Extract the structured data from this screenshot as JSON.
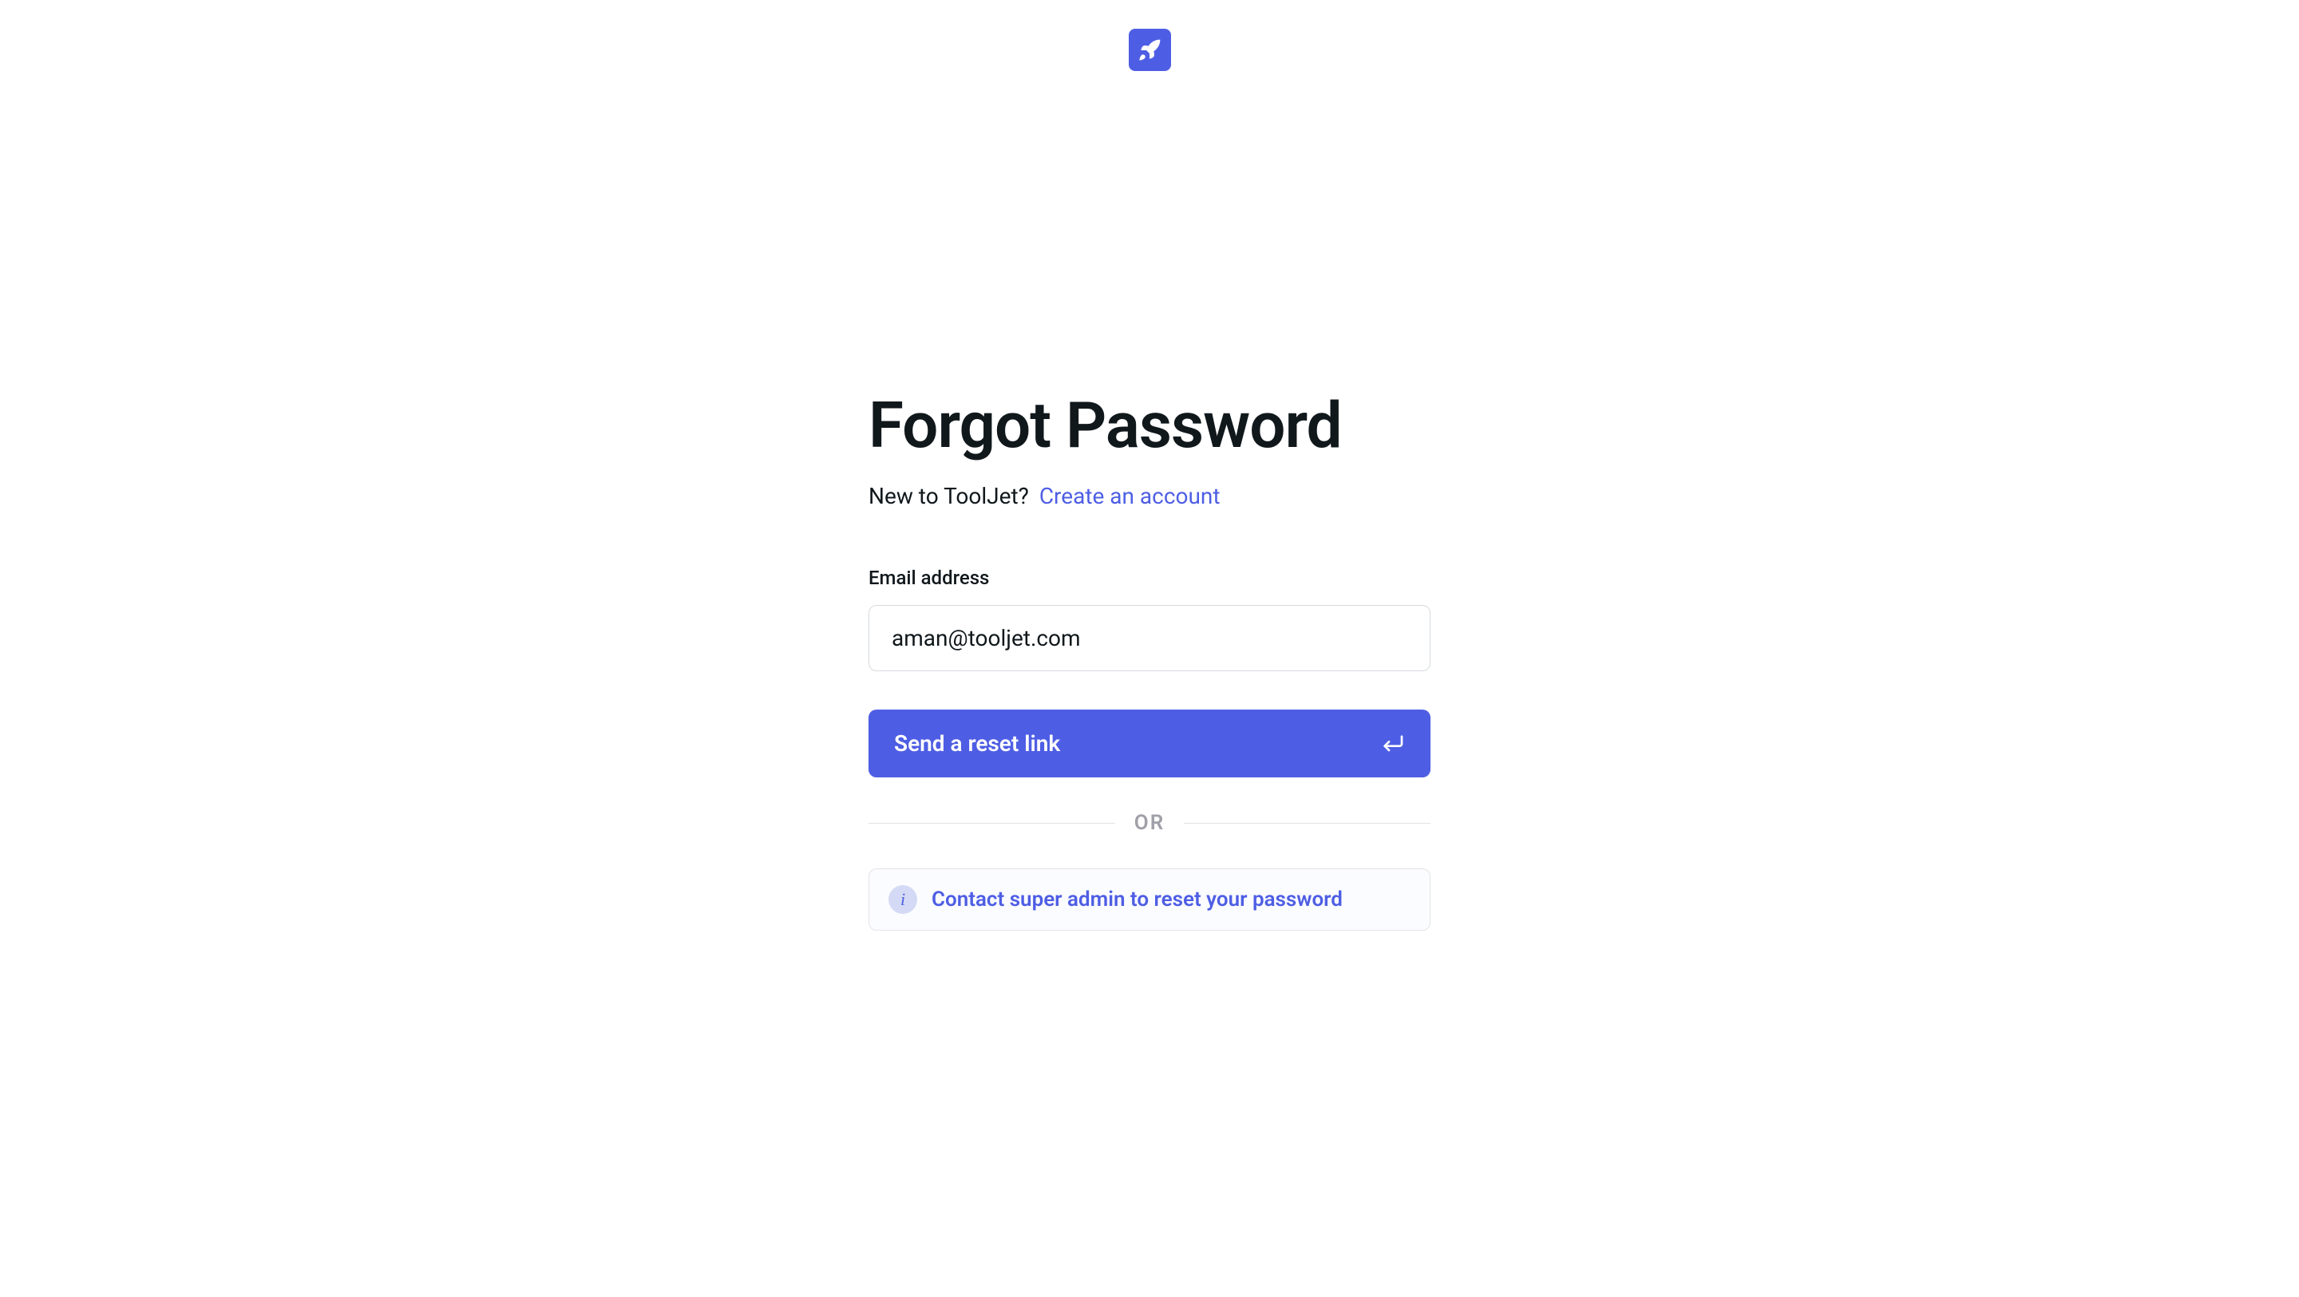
{
  "header": {
    "title": "Forgot Password",
    "signup_prompt": "New to ToolJet?",
    "signup_link": "Create an account"
  },
  "form": {
    "email_label": "Email address",
    "email_value": "aman@tooljet.com",
    "submit_label": "Send a reset link"
  },
  "divider": {
    "text": "OR"
  },
  "info": {
    "message": "Contact super admin to reset your password"
  },
  "colors": {
    "primary": "#4E5EE4",
    "text": "#11181C",
    "border": "#D7DBDF",
    "muted": "#A0A0A8"
  }
}
